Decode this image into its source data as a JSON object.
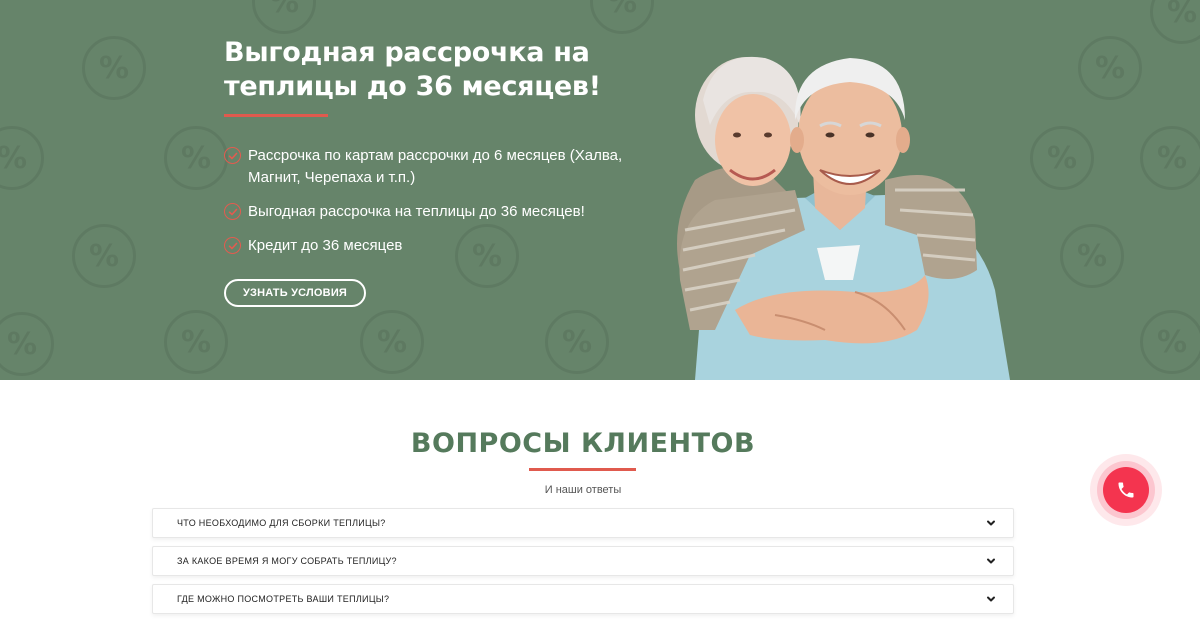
{
  "hero": {
    "title_line1": "Выгодная рассрочка на",
    "title_line2": "теплицы до 36 месяцев!",
    "bullets": [
      "Рассрочка по картам рассрочки до 6 месяцев (Халва, Магнит, Черепаха и т.п.)",
      "Выгодная рассрочка на теплицы до 36 месяцев!",
      "Кредит до 36 месяцев"
    ],
    "cta_label": "УЗНАТЬ УСЛОВИЯ",
    "pattern_glyph": "%",
    "background_color": "#66846a",
    "accent_color": "#e05a4e"
  },
  "faq": {
    "title": "ВОПРОСЫ КЛИЕНТОВ",
    "subtitle": "И наши ответы",
    "items": [
      "ЧТО НЕОБХОДИМО ДЛЯ СБОРКИ ТЕПЛИЦЫ?",
      "ЗА КАКОЕ ВРЕМЯ Я МОГУ СОБРАТЬ ТЕПЛИЦУ?",
      "ГДЕ МОЖНО ПОСМОТРЕТЬ ВАШИ ТЕПЛИЦЫ?"
    ],
    "title_color": "#557a5c"
  },
  "icons": {
    "check": "check-circle-icon",
    "chevron": "chevron-down-icon",
    "phone": "phone-icon"
  },
  "call_button_color": "#f4344f"
}
